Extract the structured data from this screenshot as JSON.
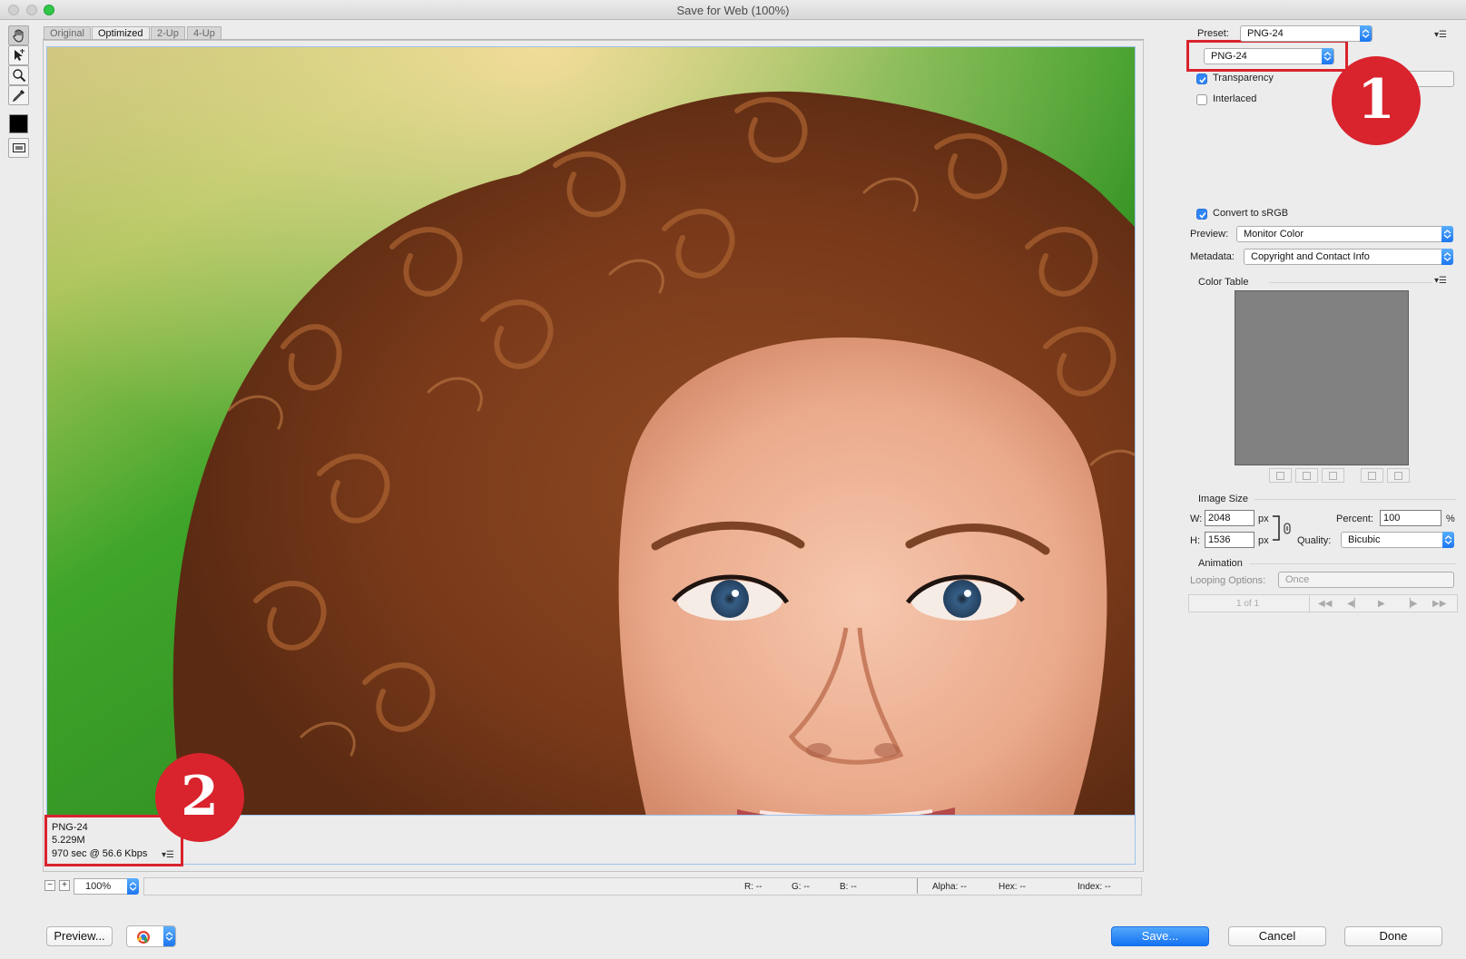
{
  "window": {
    "title": "Save for Web (100%)"
  },
  "tools": [
    "hand-tool",
    "slice-select-tool",
    "zoom-tool",
    "eyedropper-tool",
    "eyedropper-color",
    "toggle-slices-visibility"
  ],
  "tabs": [
    {
      "label": "Original"
    },
    {
      "label": "Optimized"
    },
    {
      "label": "2-Up"
    },
    {
      "label": "4-Up"
    }
  ],
  "active_tab": "Optimized",
  "annotations": {
    "badge1": "1",
    "badge2": "2"
  },
  "info": {
    "format": "PNG-24",
    "size": "5.229M",
    "download_time": "970 sec @ 56.6 Kbps"
  },
  "status": {
    "zoom": "100%",
    "r": "R: --",
    "g": "G: --",
    "b": "B: --",
    "alpha": "Alpha: --",
    "hex": "Hex: --",
    "index": "Index: --"
  },
  "buttons": {
    "preview": "Preview...",
    "save": "Save...",
    "cancel": "Cancel",
    "done": "Done"
  },
  "panel": {
    "preset_label": "Preset:",
    "preset_value": "PNG-24",
    "format_value": "PNG-24",
    "transparency_label": "Transparency",
    "transparency_checked": true,
    "interlaced_label": "Interlaced",
    "interlaced_checked": false,
    "convert_srgb_label": "Convert to sRGB",
    "convert_srgb_checked": true,
    "preview_label": "Preview:",
    "preview_value": "Monitor Color",
    "metadata_label": "Metadata:",
    "metadata_value": "Copyright and Contact Info",
    "color_table_label": "Color Table",
    "image_size_label": "Image Size",
    "w_label": "W:",
    "w_value": "2048",
    "h_label": "H:",
    "h_value": "1536",
    "px_unit": "px",
    "percent_label": "Percent:",
    "percent_value": "100",
    "percent_unit": "%",
    "quality_label": "Quality:",
    "quality_value": "Bicubic",
    "animation_label": "Animation",
    "looping_label": "Looping Options:",
    "looping_value": "Once",
    "frame_counter": "1 of 1"
  },
  "colors": {
    "accent": "#2f86f7",
    "annotation_red": "#d9232d",
    "selection_blue": "#9ec2ea"
  }
}
